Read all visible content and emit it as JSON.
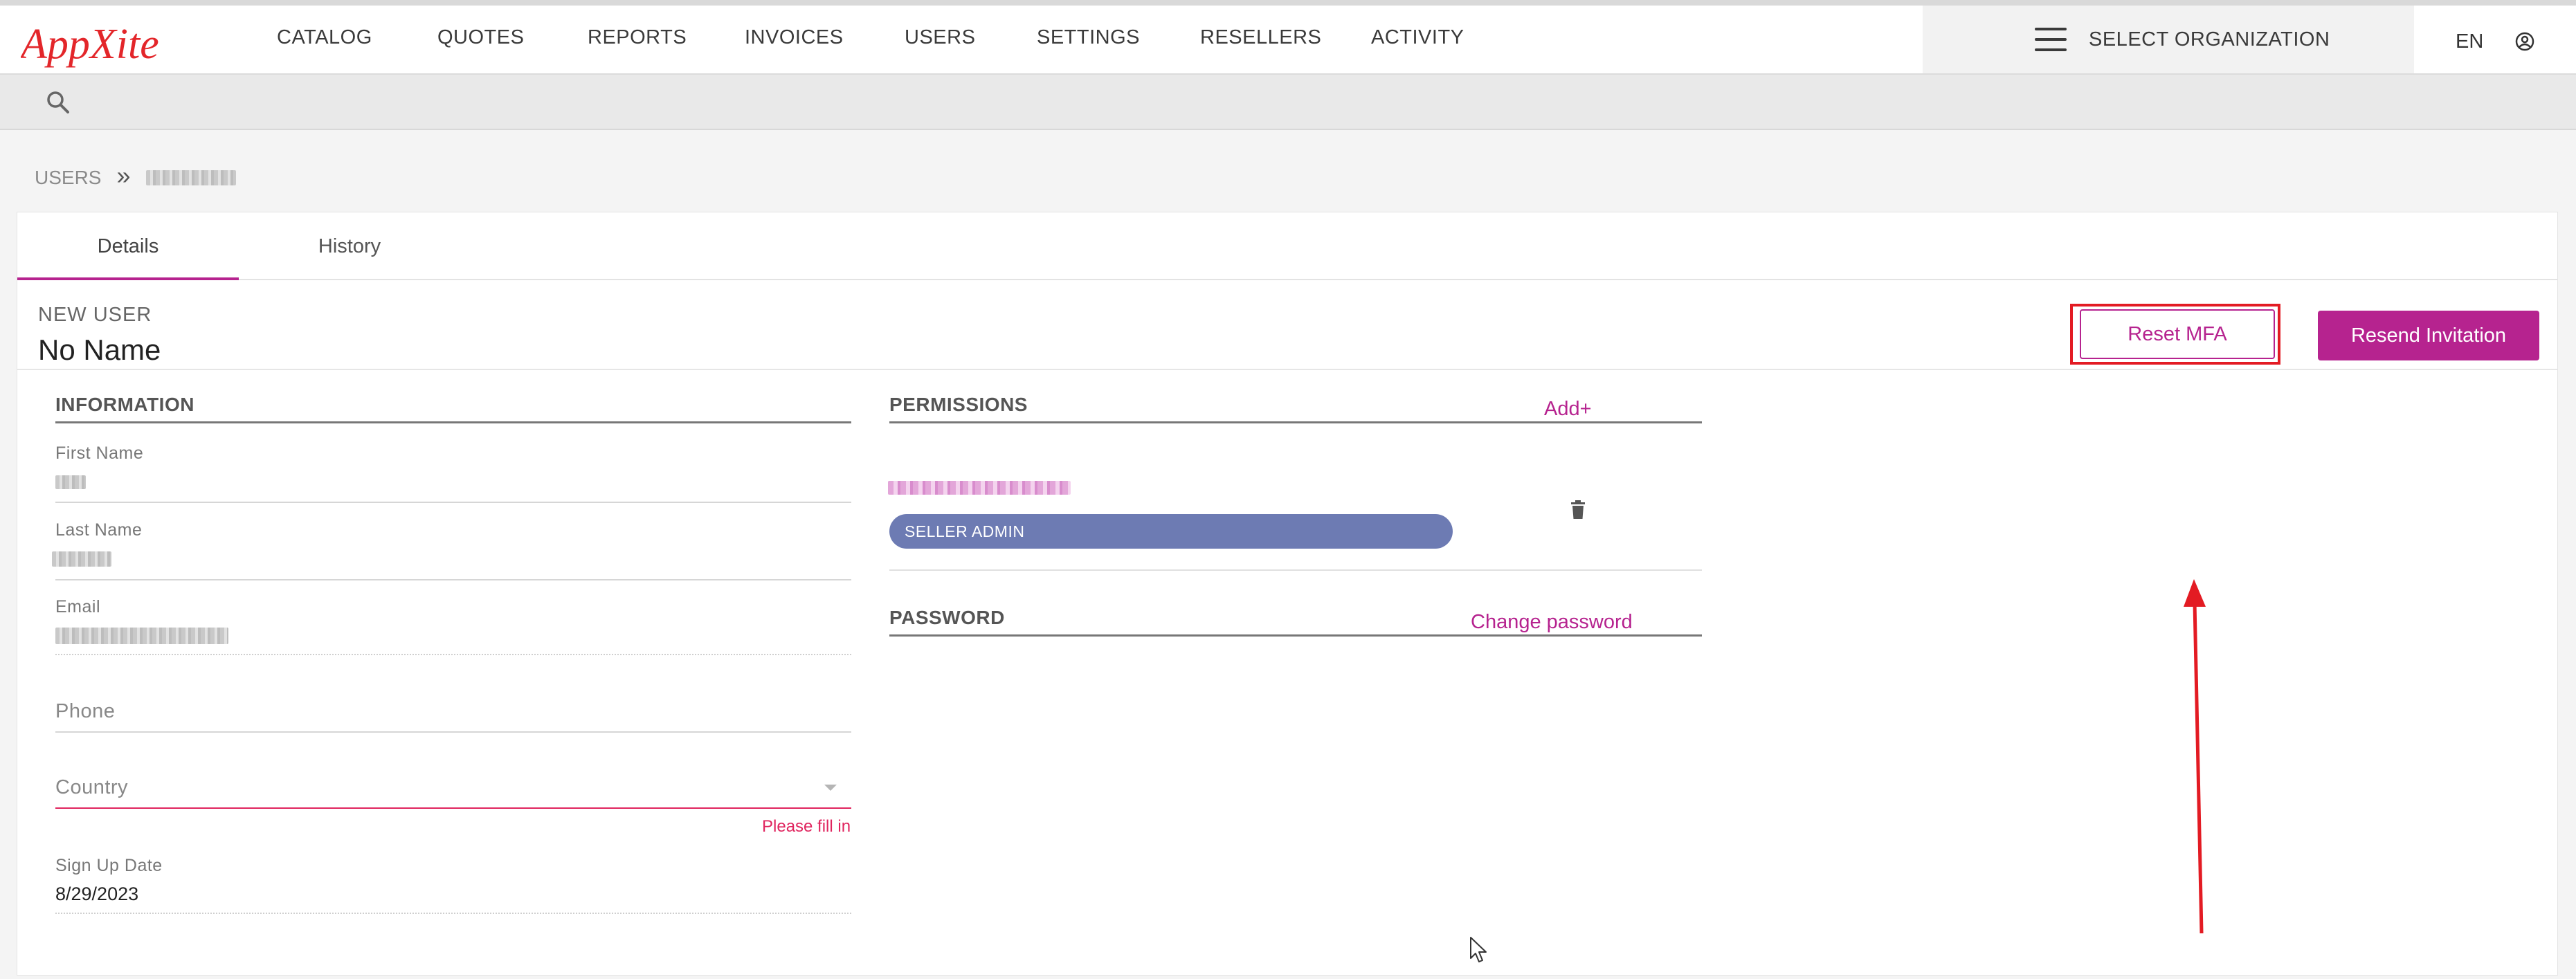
{
  "brand": {
    "logo_text": "AppXite",
    "accent": "#b6238f",
    "logo_color": "#e3262a"
  },
  "nav": {
    "items": [
      "CATALOG",
      "QUOTES",
      "REPORTS",
      "INVOICES",
      "USERS",
      "SETTINGS",
      "RESELLERS",
      "ACTIVITY"
    ],
    "org_select": "SELECT ORGANIZATION",
    "language": "EN",
    "menu_icon": "hamburger-icon",
    "user_icon": "user-circle-icon"
  },
  "search": {
    "icon": "search-icon"
  },
  "breadcrumb": {
    "root": "USERS",
    "separator": "»"
  },
  "tabs": {
    "details": "Details",
    "history": "History"
  },
  "header": {
    "subtitle": "NEW USER",
    "name": "No Name"
  },
  "actions": {
    "reset_mfa": "Reset MFA",
    "resend_invitation": "Resend Invitation"
  },
  "information": {
    "title": "INFORMATION",
    "first_name_label": "First Name",
    "last_name_label": "Last Name",
    "email_label": "Email",
    "phone_placeholder": "Phone",
    "country_placeholder": "Country",
    "country_error": "Please fill in",
    "signup_label": "Sign Up Date",
    "signup_value": "8/29/2023"
  },
  "permissions": {
    "title": "PERMISSIONS",
    "add_link": "Add+",
    "role": "SELLER ADMIN",
    "delete_icon": "trash-icon",
    "role_color": "#6d7bb3"
  },
  "password": {
    "title": "PASSWORD",
    "change_link": "Change password"
  },
  "annotation": {
    "highlight_color": "#e31b23"
  }
}
